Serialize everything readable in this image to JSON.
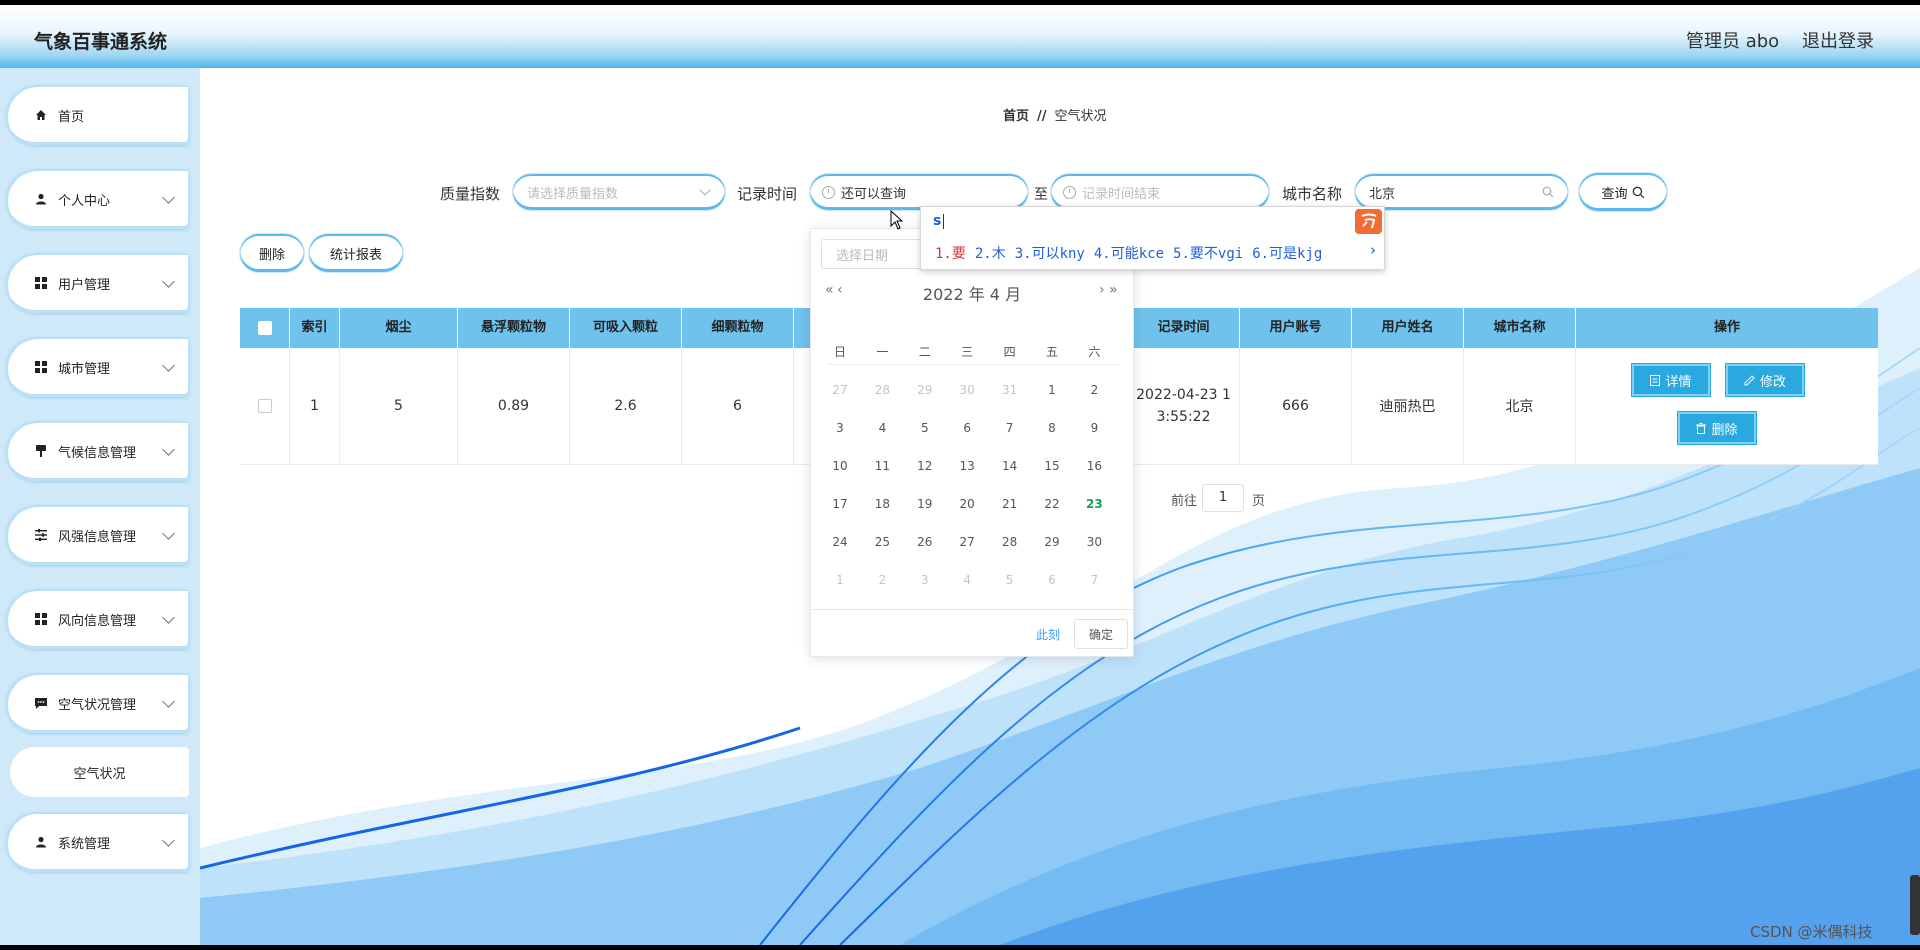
{
  "header": {
    "app_title": "气象百事通系统",
    "user_info": "管理员 abo",
    "logout": "退出登录"
  },
  "sidebar": {
    "items": [
      {
        "label": "首页",
        "icon": "home-icon"
      },
      {
        "label": "个人中心",
        "icon": "user-icon"
      },
      {
        "label": "用户管理",
        "icon": "grid-icon"
      },
      {
        "label": "城市管理",
        "icon": "grid-icon"
      },
      {
        "label": "气候信息管理",
        "icon": "brush-icon"
      },
      {
        "label": "风强信息管理",
        "icon": "sliders-icon"
      },
      {
        "label": "风向信息管理",
        "icon": "grid-icon"
      },
      {
        "label": "空气状况管理",
        "icon": "chat-icon"
      },
      {
        "label": "系统管理",
        "icon": "user-icon"
      }
    ],
    "sub_item": "空气状况"
  },
  "breadcrumb": {
    "home": "首页",
    "separator": "//",
    "current": "空气状况"
  },
  "filters": {
    "quality_label": "质量指数",
    "quality_placeholder": "请选择质量指数",
    "record_time_label": "记录时间",
    "record_time_value": "还可以查询",
    "to_label": "至",
    "record_time_end_placeholder": "记录时间结束",
    "city_label": "城市名称",
    "city_value": "北京",
    "query_button": "查询"
  },
  "actions": {
    "delete": "删除",
    "report": "统计报表"
  },
  "table": {
    "headers": [
      "索引",
      "烟尘",
      "悬浮颗粒物",
      "可吸入颗粒",
      "细颗粒物",
      "记录时间",
      "用户账号",
      "用户姓名",
      "城市名称",
      "操作"
    ],
    "rows": [
      {
        "index": "1",
        "smoke": "5",
        "suspended": "0.89",
        "inhalable": "2.6",
        "fine": "6",
        "record_time": "2022-04-23 13:55:22",
        "account": "666",
        "name": "迪丽热巴",
        "city": "北京"
      }
    ],
    "op_detail": "详情",
    "op_edit": "修改",
    "op_delete": "删除"
  },
  "pagination": {
    "goto_prefix": "前往",
    "page": "1",
    "goto_suffix": "页"
  },
  "date_picker": {
    "input_placeholder": "选择日期",
    "header": "2022 年  4 月",
    "nav_prev_year": "«",
    "nav_prev_month": "‹",
    "nav_next_month": "›",
    "nav_next_year": "»",
    "weekdays": [
      "日",
      "一",
      "二",
      "三",
      "四",
      "五",
      "六"
    ],
    "weeks": [
      [
        {
          "d": "27",
          "m": true
        },
        {
          "d": "28",
          "m": true
        },
        {
          "d": "29",
          "m": true
        },
        {
          "d": "30",
          "m": true
        },
        {
          "d": "31",
          "m": true
        },
        {
          "d": "1"
        },
        {
          "d": "2"
        }
      ],
      [
        {
          "d": "3"
        },
        {
          "d": "4"
        },
        {
          "d": "5"
        },
        {
          "d": "6"
        },
        {
          "d": "7"
        },
        {
          "d": "8"
        },
        {
          "d": "9"
        }
      ],
      [
        {
          "d": "10"
        },
        {
          "d": "11"
        },
        {
          "d": "12"
        },
        {
          "d": "13"
        },
        {
          "d": "14"
        },
        {
          "d": "15"
        },
        {
          "d": "16"
        }
      ],
      [
        {
          "d": "17"
        },
        {
          "d": "18"
        },
        {
          "d": "19"
        },
        {
          "d": "20"
        },
        {
          "d": "21"
        },
        {
          "d": "22"
        },
        {
          "d": "23",
          "today": true
        }
      ],
      [
        {
          "d": "24"
        },
        {
          "d": "25"
        },
        {
          "d": "26"
        },
        {
          "d": "27"
        },
        {
          "d": "28"
        },
        {
          "d": "29"
        },
        {
          "d": "30"
        }
      ],
      [
        {
          "d": "1",
          "m": true
        },
        {
          "d": "2",
          "m": true
        },
        {
          "d": "3",
          "m": true
        },
        {
          "d": "4",
          "m": true
        },
        {
          "d": "5",
          "m": true
        },
        {
          "d": "6",
          "m": true
        },
        {
          "d": "7",
          "m": true
        }
      ]
    ],
    "now": "此刻",
    "confirm": "确定"
  },
  "ime": {
    "typed": "s",
    "candidates": [
      "1.要",
      "2.木",
      "3.可以kny",
      "4.可能kce",
      "5.要不vgi",
      "6.可是kjg"
    ],
    "more": "›"
  },
  "watermark": "CSDN @米偶科技",
  "colors": {
    "accent": "#2aa8e0",
    "header_blue": "#4cb7ee",
    "table_header": "#6fc2ec",
    "today": "#18a058"
  }
}
